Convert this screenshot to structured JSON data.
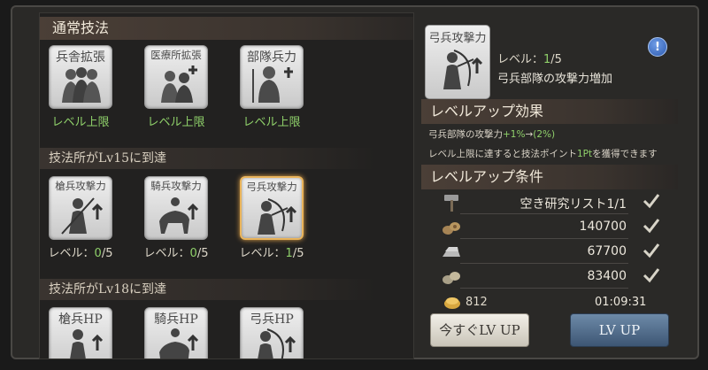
{
  "left": {
    "normal_tech_title": "通常技法",
    "normal_tiles": [
      {
        "name": "兵舎拡張",
        "caption": "レベル上限"
      },
      {
        "name": "医療所拡張",
        "caption": "レベル上限"
      },
      {
        "name": "部隊兵力",
        "caption": "レベル上限"
      }
    ],
    "group1_title": "技法所がLv15に到達",
    "group1_tiles": [
      {
        "name": "槍兵攻撃力",
        "level_label": "レベル：",
        "cur": "0",
        "max": "/5"
      },
      {
        "name": "騎兵攻撃力",
        "level_label": "レベル：",
        "cur": "0",
        "max": "/5"
      },
      {
        "name": "弓兵攻撃力",
        "level_label": "レベル：",
        "cur": "1",
        "max": "/5"
      }
    ],
    "group2_title": "技法所がLv18に到達",
    "group2_tiles": [
      {
        "name": "槍兵HP"
      },
      {
        "name": "騎兵HP"
      },
      {
        "name": "弓兵HP"
      }
    ]
  },
  "detail": {
    "tile_name": "弓兵攻撃力",
    "level_label": "レベル：",
    "level_cur": "1",
    "level_max": "/5",
    "description": "弓兵部隊の攻撃力増加",
    "info_icon": "!"
  },
  "effect": {
    "title": "レベルアップ効果",
    "line1_prefix": "弓兵部隊の攻撃力",
    "line1_from": "+1%",
    "line1_arrow": "→",
    "line1_to": "(2%)",
    "line2_prefix": "レベル上限に達すると技法ポイント",
    "line2_value": "1Pt",
    "line2_suffix": "を獲得できます"
  },
  "requirements": {
    "title": "レベルアップ条件",
    "rows": [
      {
        "icon": "hammer-icon",
        "value": "空き研究リスト1/1"
      },
      {
        "icon": "wood-icon",
        "value": "140700"
      },
      {
        "icon": "iron-icon",
        "value": "67700"
      },
      {
        "icon": "stone-icon",
        "value": "83400"
      }
    ]
  },
  "footer": {
    "gold": "812",
    "timer": "01:09:31",
    "instant_button": "今すぐLV UP",
    "levelup_button": "LV UP"
  }
}
